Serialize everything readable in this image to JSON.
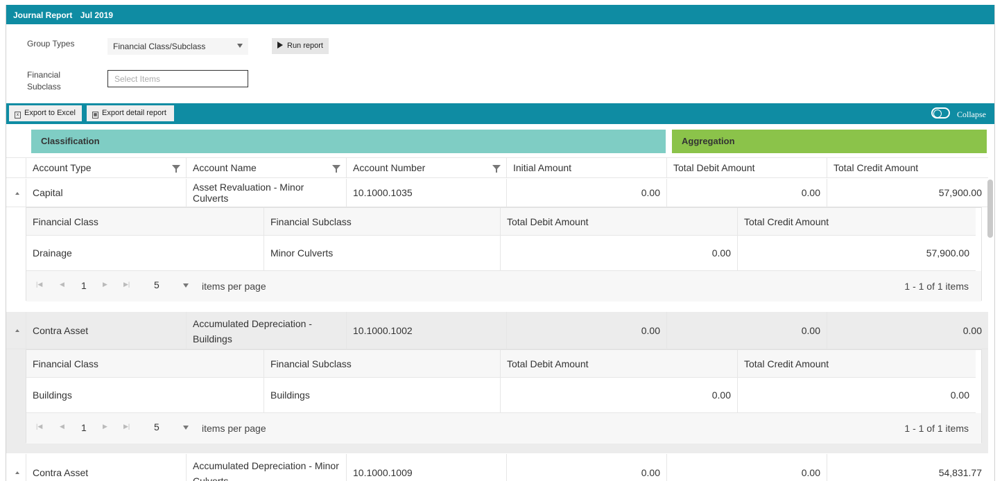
{
  "title": {
    "name": "Journal Report",
    "period": "Jul 2019"
  },
  "filters": {
    "group_types_label": "Group Types",
    "group_types_value": "Financial Class/Subclass",
    "run_label": "Run report",
    "subclass_label_line1": "Financial",
    "subclass_label_line2": "Subclass",
    "subclass_placeholder": "Select Items"
  },
  "toolbar": {
    "export_excel": "Export to Excel",
    "export_detail": "Export detail report",
    "collapse": "Collapse"
  },
  "bands": {
    "classification": "Classification",
    "aggregation": "Aggregation",
    "classification_color": "#7fcdc4",
    "aggregation_color": "#8bc34a"
  },
  "columns": [
    "Account Type",
    "Account Name",
    "Account Number",
    "Initial Amount",
    "Total Debit Amount",
    "Total Credit Amount"
  ],
  "detail_columns": [
    "Financial Class",
    "Financial Subclass",
    "Total Debit Amount",
    "Total Credit Amount"
  ],
  "rows": [
    {
      "type": "Capital",
      "name": "Asset Revaluation - Minor Culverts",
      "number": "10.1000.1035",
      "initial": "0.00",
      "debit": "0.00",
      "credit": "57,900.00",
      "detail": {
        "fclass": "Drainage",
        "fsub": "Minor Culverts",
        "debit": "0.00",
        "credit": "57,900.00"
      }
    },
    {
      "type": "Contra Asset",
      "name_line1": "Accumulated Depreciation -",
      "name_line2": "Buildings",
      "number": "10.1000.1002",
      "initial": "0.00",
      "debit": "0.00",
      "credit": "0.00",
      "detail": {
        "fclass": "Buildings",
        "fsub": "Buildings",
        "debit": "0.00",
        "credit": "0.00"
      }
    },
    {
      "type": "Contra Asset",
      "name_line1": "Accumulated Depreciation - Minor",
      "name_line2": "Culverts",
      "number": "10.1000.1009",
      "initial": "0.00",
      "debit": "0.00",
      "credit": "54,831.77"
    }
  ],
  "pager": {
    "page": "1",
    "page_size": "5",
    "per_page_label": "items per page",
    "summary": "1 - 1 of 1 items"
  }
}
